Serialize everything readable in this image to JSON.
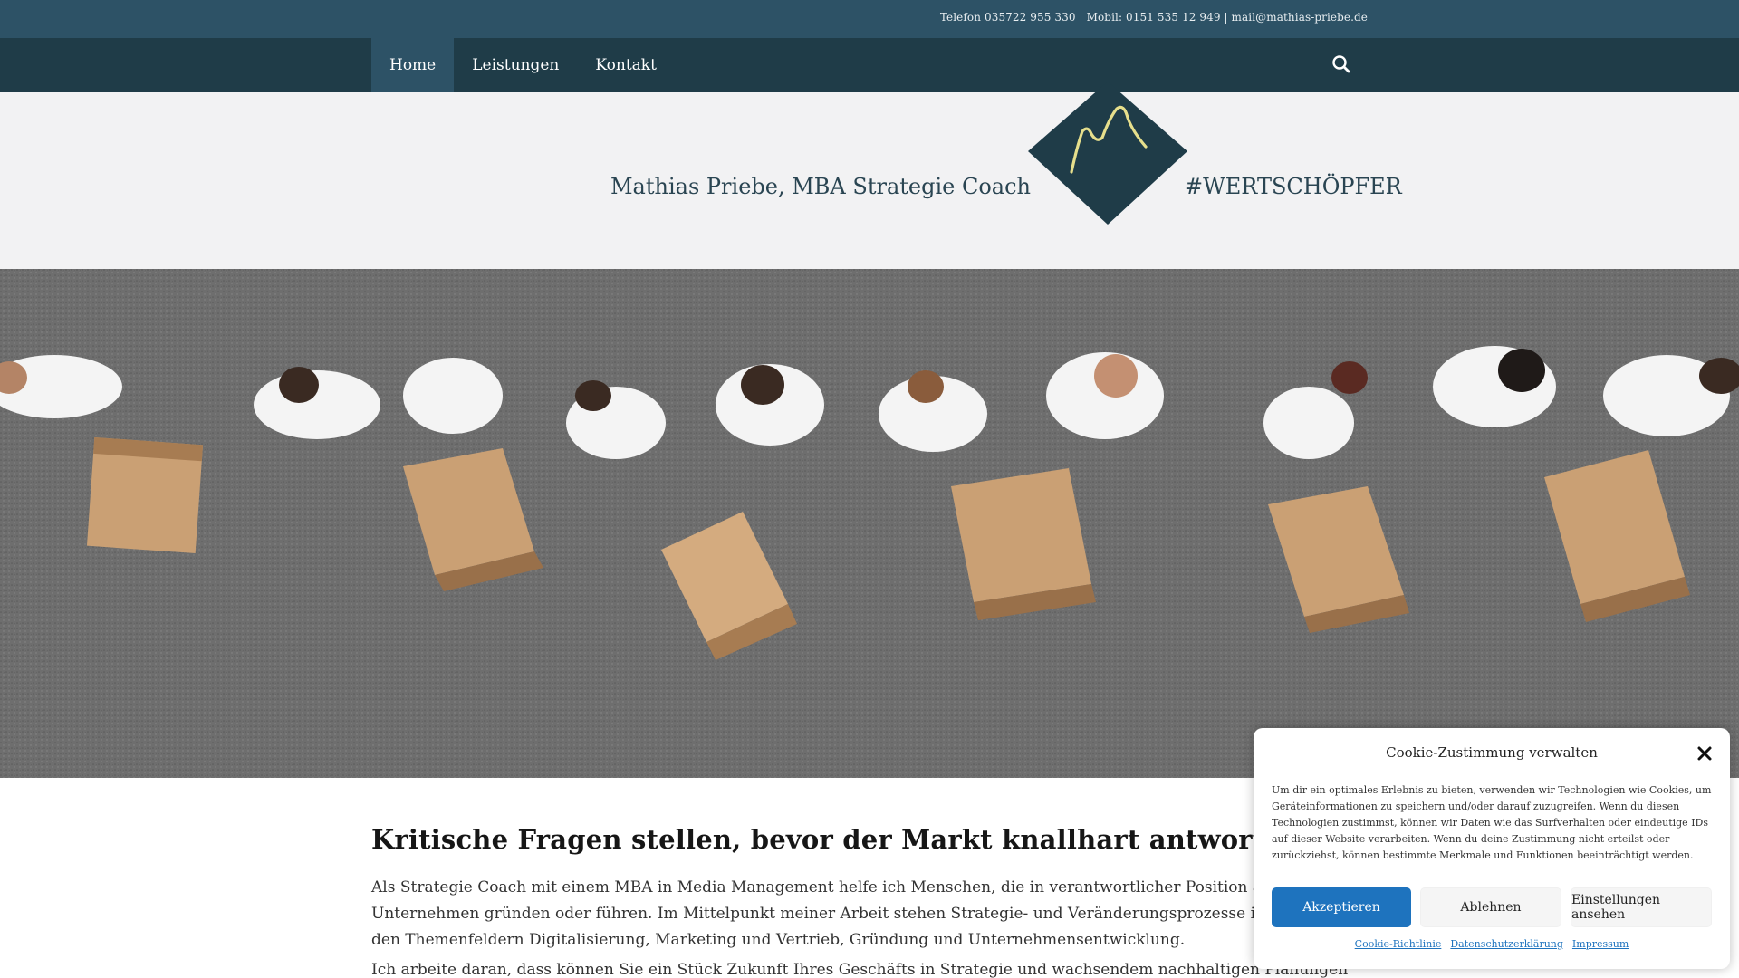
{
  "topbar": {
    "contact": "Telefon 035722 955 330 | Mobil: 0151 535 12 949 | mail@mathias-priebe.de"
  },
  "nav": {
    "items": [
      {
        "label": "Home",
        "active": true
      },
      {
        "label": "Leistungen",
        "active": false
      },
      {
        "label": "Kontakt",
        "active": false
      }
    ],
    "search_icon": "search-icon"
  },
  "brand": {
    "name": "Mathias Priebe, MBA Strategie Coach",
    "tagline": "#WERTSCHÖPFER",
    "logo_color": "#1f3c48",
    "logo_accent": "#e6df8c"
  },
  "hero": {
    "image": "people-carrying-boxes-photo"
  },
  "content": {
    "heading": "Kritische Fragen stellen, bevor der Markt knallhart antwortet!",
    "paragraph": "Als Strategie Coach mit einem MBA in Media Management helfe ich Menschen, die in verantwortlicher Position arbeiten, ein Unternehmen gründen oder führen. Im Mittelpunkt meiner Arbeit stehen Strategie- und Veränderungsprozesse in Teams in den Themenfeldern Digitalisierung, Marketing und Vertrieb, Gründung und Unternehmensentwicklung.",
    "paragraph_cut": "Ich arbeite daran, dass können Sie ein Stück Zukunft Ihres Geschäfts in Strategie und wachsendem nachhaltigen Planungen Ziele zu erreichen?"
  },
  "cookie": {
    "title": "Cookie-Zustimmung verwalten",
    "text": "Um dir ein optimales Erlebnis zu bieten, verwenden wir Technologien wie Cookies, um Geräteinformationen zu speichern und/oder darauf zuzugreifen. Wenn du diesen Technologien zustimmst, können wir Daten wie das Surfverhalten oder eindeutige IDs auf dieser Website verarbeiten. Wenn du deine Zustimmung nicht erteilst oder zurückziehst, können bestimmte Merkmale und Funktionen beeinträchtigt werden.",
    "accept": "Akzeptieren",
    "deny": "Ablehnen",
    "settings": "Einstellungen ansehen",
    "links": [
      "Cookie-Richtlinie",
      "Datenschutzerklärung",
      "Impressum"
    ],
    "accent": "#1e73be"
  }
}
